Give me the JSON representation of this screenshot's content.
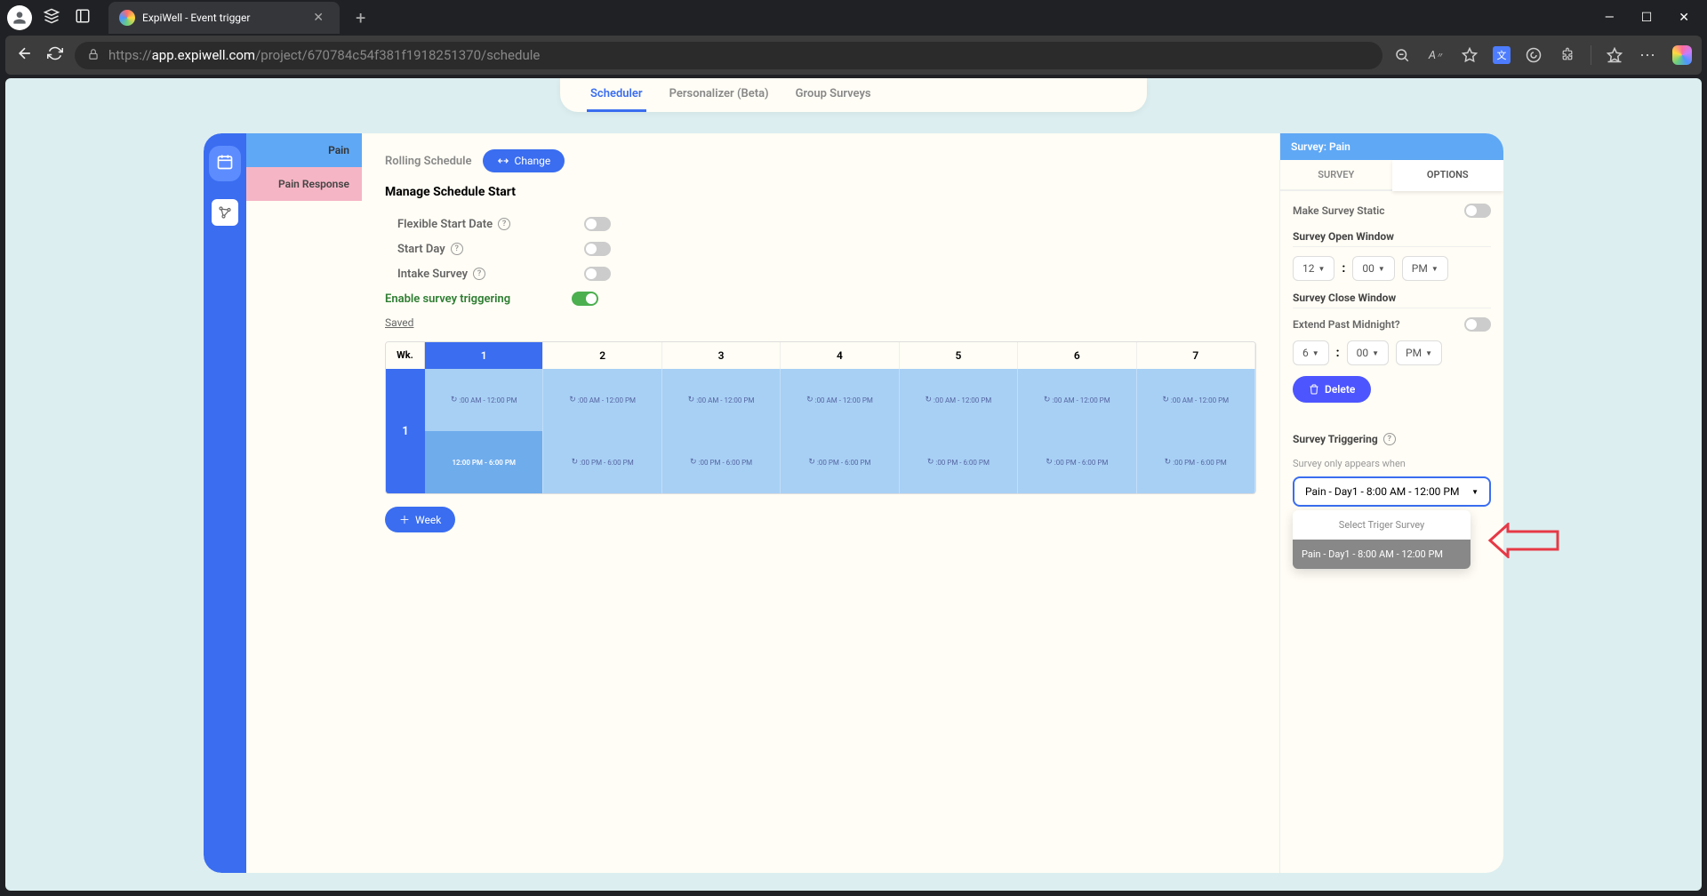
{
  "browser": {
    "tab_title": "ExpiWell - Event trigger",
    "url_prefix": "https://",
    "url_host": "app.expiwell.com",
    "url_path": "/project/670784c54f381f1918251370/schedule"
  },
  "tabs": {
    "scheduler": "Scheduler",
    "personalizer": "Personalizer (Beta)",
    "group": "Group Surveys"
  },
  "sidebar": {
    "items": [
      "Pain",
      "Pain Response"
    ]
  },
  "center": {
    "rolling_label": "Rolling Schedule",
    "change_btn": "Change",
    "manage_title": "Manage Schedule Start",
    "flex_start": "Flexible Start Date",
    "start_day": "Start Day",
    "intake": "Intake Survey",
    "enable_trigger": "Enable survey triggering",
    "saved": "Saved",
    "wk": "Wk.",
    "days": [
      "1",
      "2",
      "3",
      "4",
      "5",
      "6",
      "7"
    ],
    "week_num": "1",
    "slot_am": ":00 AM - 12:00 PM",
    "slot_pm": ":00 PM - 6:00 PM",
    "slot_am_sel": "12:00 PM - 6:00 PM",
    "add_week": "Week"
  },
  "right": {
    "header": "Survey: Pain",
    "tab_survey": "SURVEY",
    "tab_options": "OPTIONS",
    "make_static": "Make Survey Static",
    "open_window": "Survey Open Window",
    "open_h": "12",
    "open_m": "00",
    "open_ap": "PM",
    "close_window": "Survey Close Window",
    "extend_midnight": "Extend Past Midnight?",
    "close_h": "6",
    "close_m": "00",
    "close_ap": "PM",
    "delete": "Delete",
    "triggering": "Survey Triggering",
    "appears_when": "Survey only appears when",
    "selected_trigger": "Pain - Day1 - 8:00 AM - 12:00 PM",
    "dd_header": "Select Triger Survey",
    "dd_option": "Pain - Day1 - 8:00 AM - 12:00 PM"
  }
}
